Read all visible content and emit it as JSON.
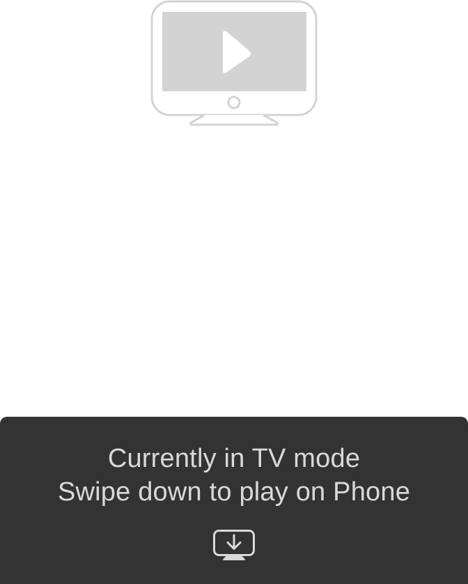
{
  "mode_panel": {
    "status_line": "Currently in TV mode",
    "hint_line": "Swipe down to play on Phone",
    "action_icon": "tv-download-icon"
  },
  "illustration": {
    "icon": "tv-play-icon"
  },
  "colors": {
    "background": "#ffffff",
    "panel": "#333333",
    "panel_text": "#d9d9d9",
    "illustration": "#d3d3d3"
  }
}
